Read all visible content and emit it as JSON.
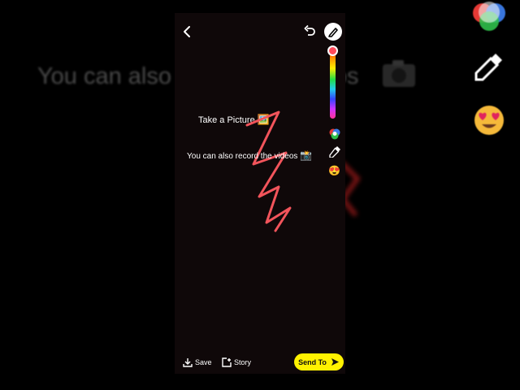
{
  "backdrop": {
    "caption": "You can also record the videos"
  },
  "screen": {
    "captions": [
      {
        "text": "Take a Picture",
        "emoji": "🖼️"
      },
      {
        "text": "You can also record the videos",
        "emoji": "📸"
      }
    ],
    "toolbar": {
      "icons": [
        "back-icon",
        "undo-icon",
        "pen-icon",
        "color-slider",
        "palette-icon",
        "dropper-icon",
        "emoji-icon"
      ],
      "emoji": "😍",
      "selected_color": "#ff4a5a"
    },
    "bottom": {
      "save_label": "Save",
      "story_label": "Story",
      "send_label": "Send To",
      "send_color": "#fff200"
    }
  }
}
